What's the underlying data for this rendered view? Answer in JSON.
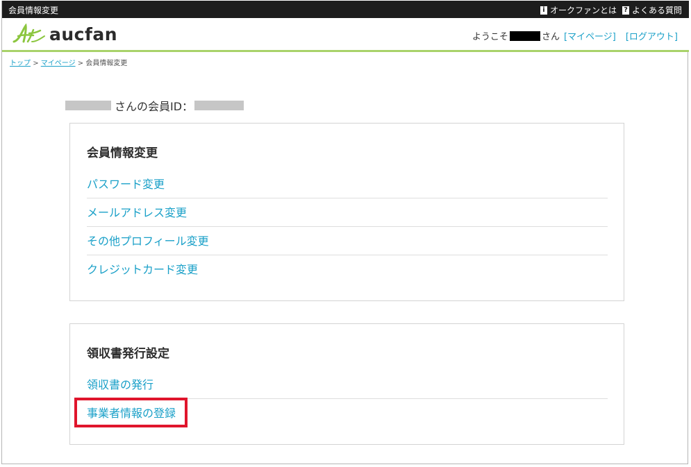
{
  "window": {
    "title": "会員情報変更"
  },
  "topbar": {
    "about": {
      "badge": "i",
      "label": "オークファンとは"
    },
    "faq": {
      "badge": "?",
      "label": "よくある質問"
    }
  },
  "brand": {
    "logo_text": "aucfan",
    "accent": "#a9d26a",
    "link_color": "#1aa0c8",
    "highlight": "#e0152c"
  },
  "header": {
    "welcome": "ようこそ",
    "suffix": "さん",
    "mypage": "[マイページ]",
    "logout": "[ログアウト]"
  },
  "breadcrumb": {
    "top": "トップ",
    "mypage": "マイページ",
    "current": "会員情報変更",
    "separator": ">"
  },
  "member": {
    "label": "さんの会員ID："
  },
  "sections": [
    {
      "title": "会員情報変更",
      "items": [
        "パスワード変更",
        "メールアドレス変更",
        "その他プロフィール変更",
        "クレジットカード変更"
      ]
    },
    {
      "title": "領収書発行設定",
      "items": [
        "領収書の発行",
        "事業者情報の登録"
      ]
    }
  ]
}
